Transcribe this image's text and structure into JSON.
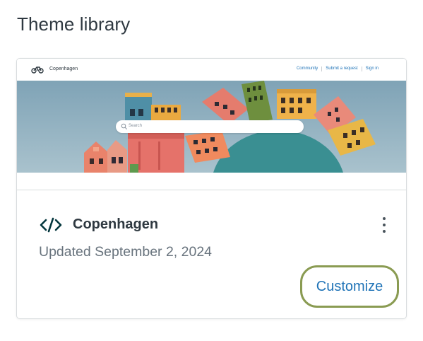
{
  "page": {
    "heading": "Theme library"
  },
  "theme_card": {
    "preview": {
      "brand": "Copenhagen",
      "nav": [
        "Community",
        "Submit a request",
        "Sign in"
      ],
      "search_placeholder": "Search",
      "logo_icon": "bicycle-icon",
      "colors": {
        "sky": "#8fb0c0",
        "link": "#1f73b7"
      }
    },
    "name": "Copenhagen",
    "icon": "code-icon",
    "updated": "Updated September 2, 2024",
    "menu_icon": "kebab-menu-icon",
    "customize_label": "Customize",
    "colors": {
      "focus_ring": "#8a9b52",
      "accent": "#1f73b7",
      "text": "#2f3941",
      "muted": "#68737d"
    }
  }
}
